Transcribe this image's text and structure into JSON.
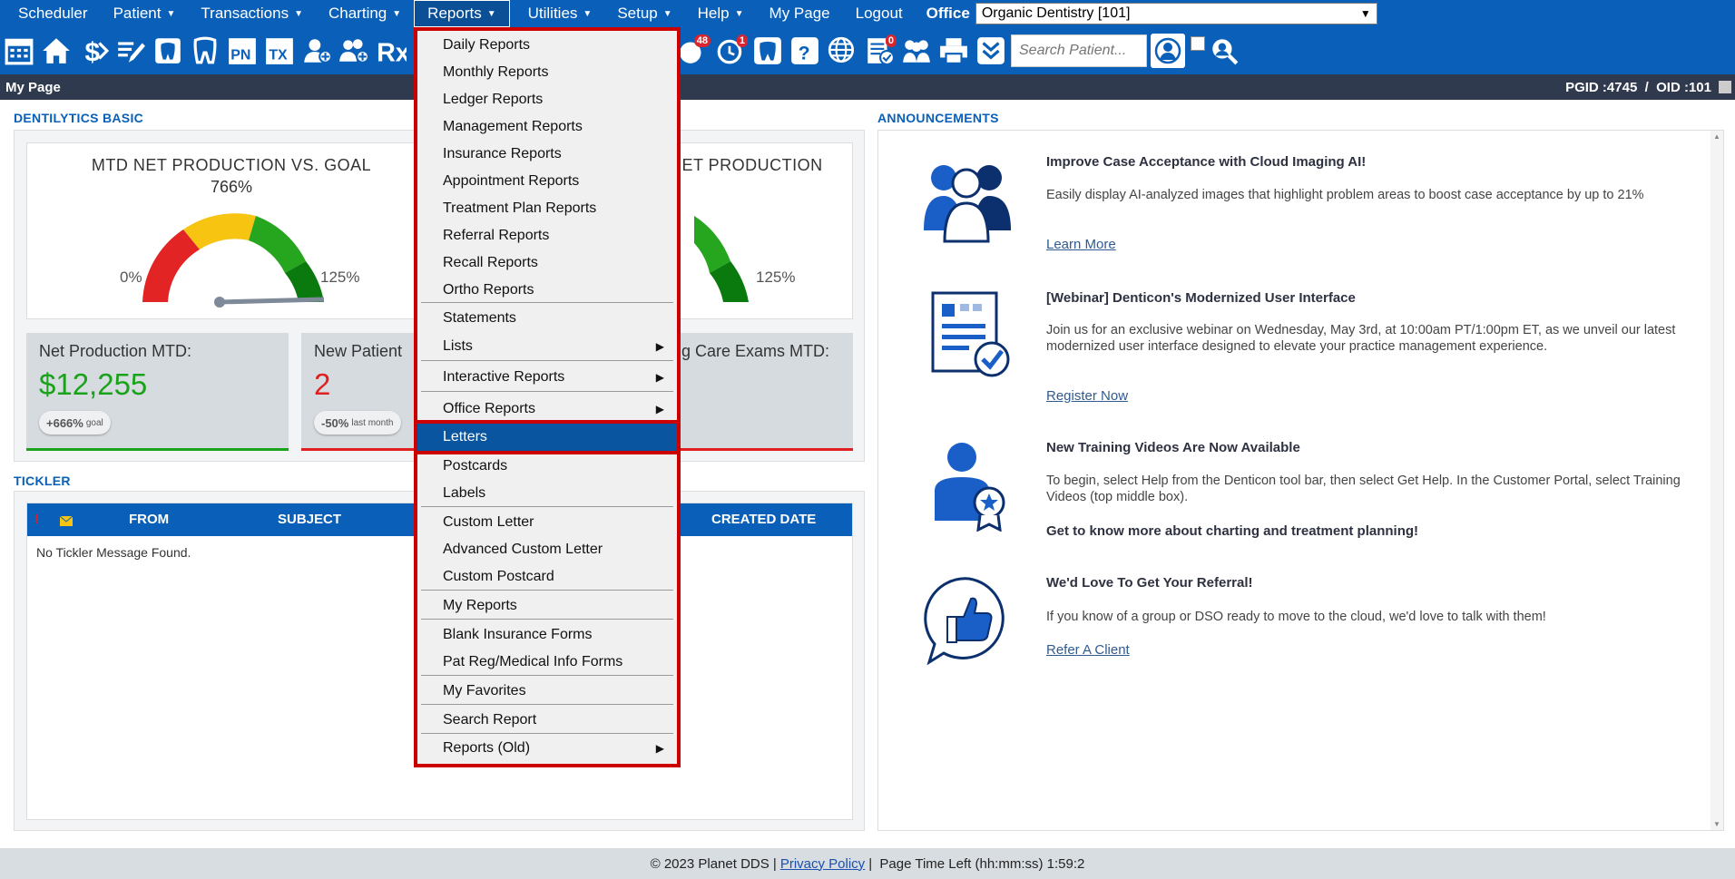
{
  "menubar": {
    "items": [
      {
        "label": "Scheduler",
        "caret": false
      },
      {
        "label": "Patient",
        "caret": true
      },
      {
        "label": "Transactions",
        "caret": true
      },
      {
        "label": "Charting",
        "caret": true
      },
      {
        "label": "Reports",
        "caret": true,
        "active": true
      },
      {
        "label": "Utilities",
        "caret": true
      },
      {
        "label": "Setup",
        "caret": true
      },
      {
        "label": "Help",
        "caret": true
      },
      {
        "label": "My Page",
        "caret": false
      },
      {
        "label": "Logout",
        "caret": false
      }
    ],
    "office_label": "Office",
    "office_value": "Organic Dentistry [101]"
  },
  "toolbar": {
    "icons": [
      "calendar-icon",
      "home-icon",
      "dollar-icon",
      "edit-icon",
      "tooth-icon",
      "tooth-chart-icon",
      "pn-icon",
      "tx-icon",
      "add-patient-icon",
      "add-family-icon",
      "rx-icon"
    ],
    "pn_label": "PN",
    "tx_label": "TX",
    "rx_label": "Rx",
    "badge_messages": "48",
    "badge_recall": "1",
    "badge_tasks": "0",
    "search_placeholder": "Search Patient..."
  },
  "titlebar": {
    "page_title": "My Page",
    "ids": "PGID :4745  /  OID :101"
  },
  "dentilytics": {
    "section_title": "DENTILYTICS BASIC",
    "gauge1": {
      "title": "MTD NET PRODUCTION VS. GOAL",
      "value": "766%",
      "min": "0%",
      "max": "125%"
    },
    "gauge2": {
      "title": "NET PRODUCTION",
      "max": "125%"
    },
    "stats": [
      {
        "label": "Net Production MTD:",
        "value": "$12,255",
        "pill": "+666%",
        "pill_suffix": "goal",
        "color": "#1aa31a"
      },
      {
        "label": "New Patient",
        "value": "2",
        "pill": "-50%",
        "pill_suffix": "last month",
        "color": "#e02020"
      },
      {
        "label": "g Care Exams MTD:",
        "value": "",
        "pill": "",
        "pill_suffix": "",
        "color": "#e02020"
      }
    ]
  },
  "tickler": {
    "section_title": "TICKLER",
    "col_from": "FROM",
    "col_subject": "SUBJECT",
    "col_created": "CREATED DATE",
    "priority_mark": "!",
    "empty": "No Tickler Message Found."
  },
  "announcements": {
    "section_title": "ANNOUNCEMENTS",
    "items": [
      {
        "title": "Improve Case Acceptance with Cloud Imaging AI!",
        "body": "Easily display AI-analyzed images that highlight problem areas to boost case acceptance by up to 21%",
        "link": "Learn More"
      },
      {
        "title": "[Webinar] Denticon's Modernized User Interface",
        "body": "Join us for an exclusive webinar on Wednesday, May 3rd, at 10:00am PT/1:00pm ET, as we unveil our latest modernized user interface designed to elevate your practice management experience.",
        "link": "Register Now"
      },
      {
        "title": "New Training Videos Are Now Available",
        "body": "To begin, select Help from the Denticon tool bar, then select Get Help. In the Customer Portal, select Training Videos (top middle box).",
        "strong": "Get to know more about charting and treatment planning!"
      },
      {
        "title": "We'd Love To Get Your Referral!",
        "body": "If you know of a group or DSO ready to move to the cloud, we'd love to talk with them!",
        "link": "Refer A Client"
      }
    ]
  },
  "footer": {
    "copyright": "© 2023 Planet DDS |",
    "privacy": "Privacy Policy",
    "time_left": "|  Page Time Left (hh:mm:ss) 1:59:2"
  },
  "reports_menu": {
    "items": [
      {
        "label": "Daily Reports"
      },
      {
        "label": "Monthly Reports"
      },
      {
        "label": "Ledger Reports"
      },
      {
        "label": "Management Reports"
      },
      {
        "label": "Insurance Reports"
      },
      {
        "label": "Appointment Reports"
      },
      {
        "label": "Treatment Plan Reports"
      },
      {
        "label": "Referral Reports"
      },
      {
        "label": "Recall Reports"
      },
      {
        "label": "Ortho Reports"
      },
      {
        "label": "Statements"
      },
      {
        "label": "Lists",
        "submenu": true
      },
      {
        "label": "Interactive Reports",
        "submenu": true
      },
      {
        "label": "Office Reports",
        "submenu": true
      },
      {
        "label": "Letters",
        "highlighted": true
      },
      {
        "label": "Postcards"
      },
      {
        "label": "Labels"
      },
      {
        "label": "Custom Letter"
      },
      {
        "label": "Advanced Custom Letter"
      },
      {
        "label": "Custom Postcard"
      },
      {
        "label": "My Reports"
      },
      {
        "label": "Blank Insurance Forms"
      },
      {
        "label": "Pat Reg/Medical Info Forms"
      },
      {
        "label": "My Favorites"
      },
      {
        "label": "Search Report"
      },
      {
        "label": "Reports (Old)",
        "submenu": true
      }
    ]
  }
}
